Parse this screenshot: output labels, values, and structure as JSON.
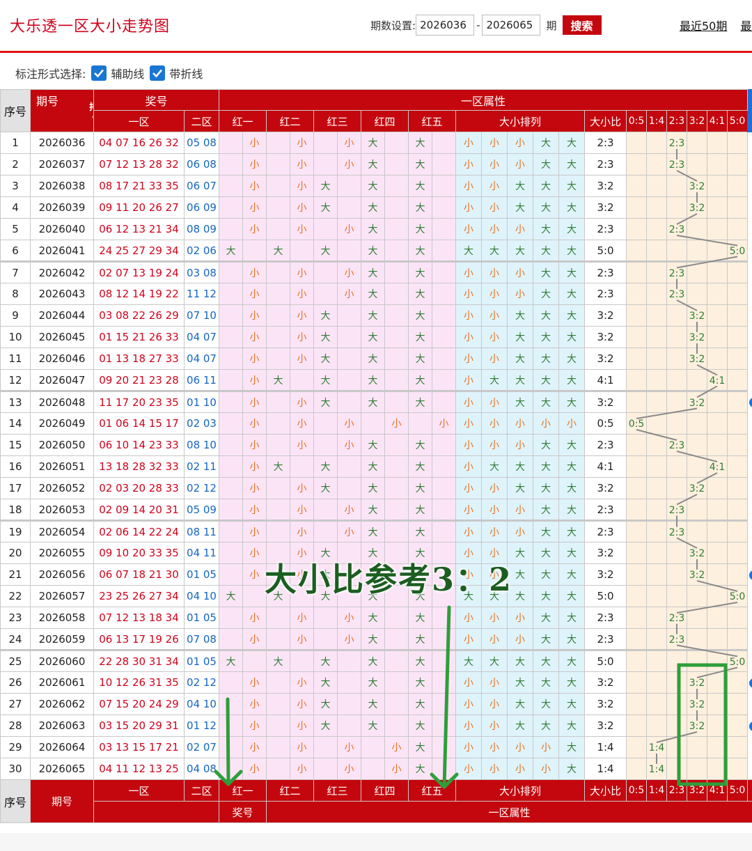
{
  "header": {
    "title": "大乐透一区大小走势图",
    "period_label": "期数设置:",
    "start_period": "2026036",
    "dash": "-",
    "end_period": "2026065",
    "unit": "期",
    "search_label": "搜索",
    "links": [
      "最近50期",
      "最近"
    ]
  },
  "options": {
    "label": "标注形式选择:",
    "aux_line": "辅助线",
    "fold_line": "带折线"
  },
  "table_head": {
    "serial": "序号",
    "issue": "期号",
    "sort": "排序",
    "prize": "奖号",
    "zone1": "一区",
    "zone2": "二区",
    "attr": "一区属性",
    "reds": [
      "红一",
      "红二",
      "红三",
      "红四",
      "红五"
    ],
    "arrange": "大小排列",
    "ratio": "大小比",
    "ratio_cols": [
      "0:5",
      "1:4",
      "2:3",
      "3:2",
      "4:1",
      "5:0"
    ]
  },
  "table_foot": {
    "serial": "序号",
    "issue": "期号",
    "zone1": "一区",
    "zone2": "二区",
    "reds": [
      "红一",
      "红二",
      "红三",
      "红四",
      "红五"
    ],
    "arrange": "大小排列",
    "ratio": "大小比",
    "ratio_cols": [
      "0:5",
      "1:4",
      "2:3",
      "3:2",
      "4:1",
      "5:0"
    ],
    "prize": "奖号",
    "attr": "一区属性"
  },
  "labels": {
    "big": "大",
    "small": "小"
  },
  "rows": [
    {
      "no": "1",
      "issue": "2026036",
      "zone1": "04 07 16 26 32",
      "zone2": "05 08",
      "sizes": "SSSBB",
      "ratio": "2:3"
    },
    {
      "no": "2",
      "issue": "2026037",
      "zone1": "07 12 13 28 32",
      "zone2": "06 08",
      "sizes": "SSSBB",
      "ratio": "2:3"
    },
    {
      "no": "3",
      "issue": "2026038",
      "zone1": "08 17 21 33 35",
      "zone2": "06 07",
      "sizes": "SSBBB",
      "ratio": "3:2"
    },
    {
      "no": "4",
      "issue": "2026039",
      "zone1": "09 11 20 26 27",
      "zone2": "06 09",
      "sizes": "SSBBB",
      "ratio": "3:2"
    },
    {
      "no": "5",
      "issue": "2026040",
      "zone1": "06 12 13 21 34",
      "zone2": "08 09",
      "sizes": "SSSBB",
      "ratio": "2:3"
    },
    {
      "no": "6",
      "issue": "2026041",
      "zone1": "24 25 27 29 34",
      "zone2": "02 06",
      "sizes": "BBBBB",
      "ratio": "5:0"
    },
    {
      "no": "7",
      "issue": "2026042",
      "zone1": "02 07 13 19 24",
      "zone2": "03 08",
      "sizes": "SSSBB",
      "ratio": "2:3"
    },
    {
      "no": "8",
      "issue": "2026043",
      "zone1": "08 12 14 19 22",
      "zone2": "11 12",
      "sizes": "SSSBB",
      "ratio": "2:3"
    },
    {
      "no": "9",
      "issue": "2026044",
      "zone1": "03 08 22 26 29",
      "zone2": "07 10",
      "sizes": "SSBBB",
      "ratio": "3:2"
    },
    {
      "no": "10",
      "issue": "2026045",
      "zone1": "01 15 21 26 33",
      "zone2": "04 07",
      "sizes": "SSBBB",
      "ratio": "3:2"
    },
    {
      "no": "11",
      "issue": "2026046",
      "zone1": "01 13 18 27 33",
      "zone2": "04 07",
      "sizes": "SSBBB",
      "ratio": "3:2"
    },
    {
      "no": "12",
      "issue": "2026047",
      "zone1": "09 20 21 23 28",
      "zone2": "06 11",
      "sizes": "SBBBB",
      "ratio": "4:1"
    },
    {
      "no": "13",
      "issue": "2026048",
      "zone1": "11 17 20 23 35",
      "zone2": "01 10",
      "sizes": "SSBBB",
      "ratio": "3:2"
    },
    {
      "no": "14",
      "issue": "2026049",
      "zone1": "01 06 14 15 17",
      "zone2": "02 03",
      "sizes": "SSSSS",
      "ratio": "0:5"
    },
    {
      "no": "15",
      "issue": "2026050",
      "zone1": "06 10 14 23 33",
      "zone2": "08 10",
      "sizes": "SSSBB",
      "ratio": "2:3"
    },
    {
      "no": "16",
      "issue": "2026051",
      "zone1": "13 18 28 32 33",
      "zone2": "02 11",
      "sizes": "SBBBB",
      "ratio": "4:1"
    },
    {
      "no": "17",
      "issue": "2026052",
      "zone1": "02 03 20 28 33",
      "zone2": "02 12",
      "sizes": "SSBBB",
      "ratio": "3:2"
    },
    {
      "no": "18",
      "issue": "2026053",
      "zone1": "02 09 14 20 31",
      "zone2": "05 09",
      "sizes": "SSSBB",
      "ratio": "2:3"
    },
    {
      "no": "19",
      "issue": "2026054",
      "zone1": "02 06 14 22 24",
      "zone2": "08 11",
      "sizes": "SSSBB",
      "ratio": "2:3"
    },
    {
      "no": "20",
      "issue": "2026055",
      "zone1": "09 10 20 33 35",
      "zone2": "04 11",
      "sizes": "SSBBB",
      "ratio": "3:2"
    },
    {
      "no": "21",
      "issue": "2026056",
      "zone1": "06 07 18 21 30",
      "zone2": "01 05",
      "sizes": "SSBBB",
      "ratio": "3:2"
    },
    {
      "no": "22",
      "issue": "2026057",
      "zone1": "23 25 26 27 34",
      "zone2": "04 10",
      "sizes": "BBBBB",
      "ratio": "5:0"
    },
    {
      "no": "23",
      "issue": "2026058",
      "zone1": "07 12 13 18 34",
      "zone2": "01 05",
      "sizes": "SSSBB",
      "ratio": "2:3"
    },
    {
      "no": "24",
      "issue": "2026059",
      "zone1": "06 13 17 19 26",
      "zone2": "07 08",
      "sizes": "SSSBB",
      "ratio": "2:3"
    },
    {
      "no": "25",
      "issue": "2026060",
      "zone1": "22 28 30 31 34",
      "zone2": "01 05",
      "sizes": "BBBBB",
      "ratio": "5:0"
    },
    {
      "no": "26",
      "issue": "2026061",
      "zone1": "10 12 26 31 35",
      "zone2": "02 12",
      "sizes": "SSBBB",
      "ratio": "3:2"
    },
    {
      "no": "27",
      "issue": "2026062",
      "zone1": "07 15 20 24 29",
      "zone2": "04 10",
      "sizes": "SSBBB",
      "ratio": "3:2"
    },
    {
      "no": "28",
      "issue": "2026063",
      "zone1": "03 15 20 29 31",
      "zone2": "01 12",
      "sizes": "SSBBB",
      "ratio": "3:2"
    },
    {
      "no": "29",
      "issue": "2026064",
      "zone1": "03 13 15 17 21",
      "zone2": "02 07",
      "sizes": "SSSSB",
      "ratio": "1:4"
    },
    {
      "no": "30",
      "issue": "2026065",
      "zone1": "04 11 12 13 25",
      "zone2": "04 08",
      "sizes": "SSSSB",
      "ratio": "1:4"
    }
  ],
  "annotation": {
    "text": "大小比参考3：2",
    "color": "#1b5e20",
    "arrow_color": "#2e9e3a",
    "box_color": "#2e9e3a"
  },
  "colors": {
    "brand_red": "#c4070e",
    "pink": "#fce4f7",
    "cyan": "#dff3fb",
    "cream": "#fdf0de",
    "small": "#e8701a",
    "big": "#2e7d32",
    "checkbox": "#1976d2"
  },
  "icons": [
    "checkbox-checked-icon",
    "sort-arrows-icon"
  ]
}
